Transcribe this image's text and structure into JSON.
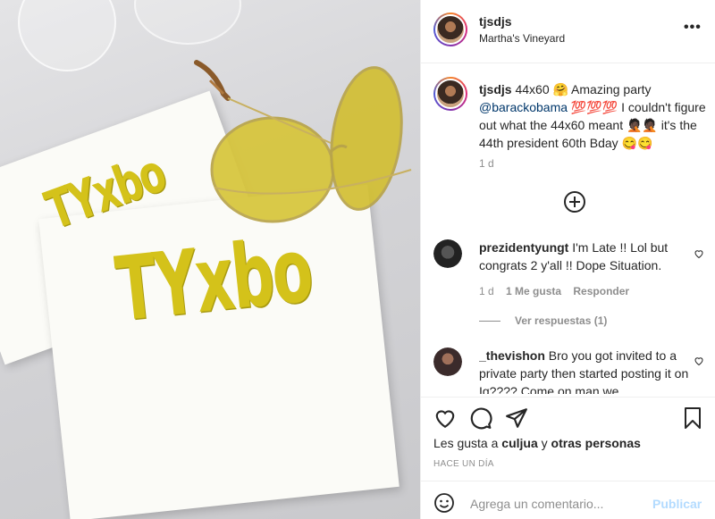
{
  "post": {
    "username": "tjsdjs",
    "location": "Martha's Vineyard",
    "more_label": "•••",
    "napkin_text": "TYxbo"
  },
  "caption": {
    "username": "tjsdjs",
    "text_before": " 44x60 🤗 Amazing party ",
    "mention": "@barackobama",
    "text_after": " 💯💯💯 I couldn't figure out what the 44x60 meant 🤦🏿🤦🏿 it's the 44th president 60th Bday 😋😋",
    "time": "1 d"
  },
  "comments": [
    {
      "username": "prezidentyungt",
      "text": " I'm Late !! Lol but congrats 2 y'all !! Dope Situation.",
      "time": "1 d",
      "likes": "1 Me gusta",
      "reply_label": "Responder",
      "view_replies": "Ver respuestas (1)"
    },
    {
      "username": "_thevishon",
      "text": " Bro you got invited to a private party then started posting it on Ig???? Come on man we"
    }
  ],
  "likes": {
    "prefix": "Les gusta a ",
    "user": "culjua",
    "middle": " y ",
    "others": "otras personas"
  },
  "post_time": "HACE UN DÍA",
  "add_comment": {
    "placeholder": "Agrega un comentario...",
    "publish_label": "Publicar"
  },
  "colors": {
    "link": "#00376b",
    "muted": "#8e8e8e",
    "publish_disabled": "#b3dbff",
    "foil_gold": "#d4c21a"
  }
}
